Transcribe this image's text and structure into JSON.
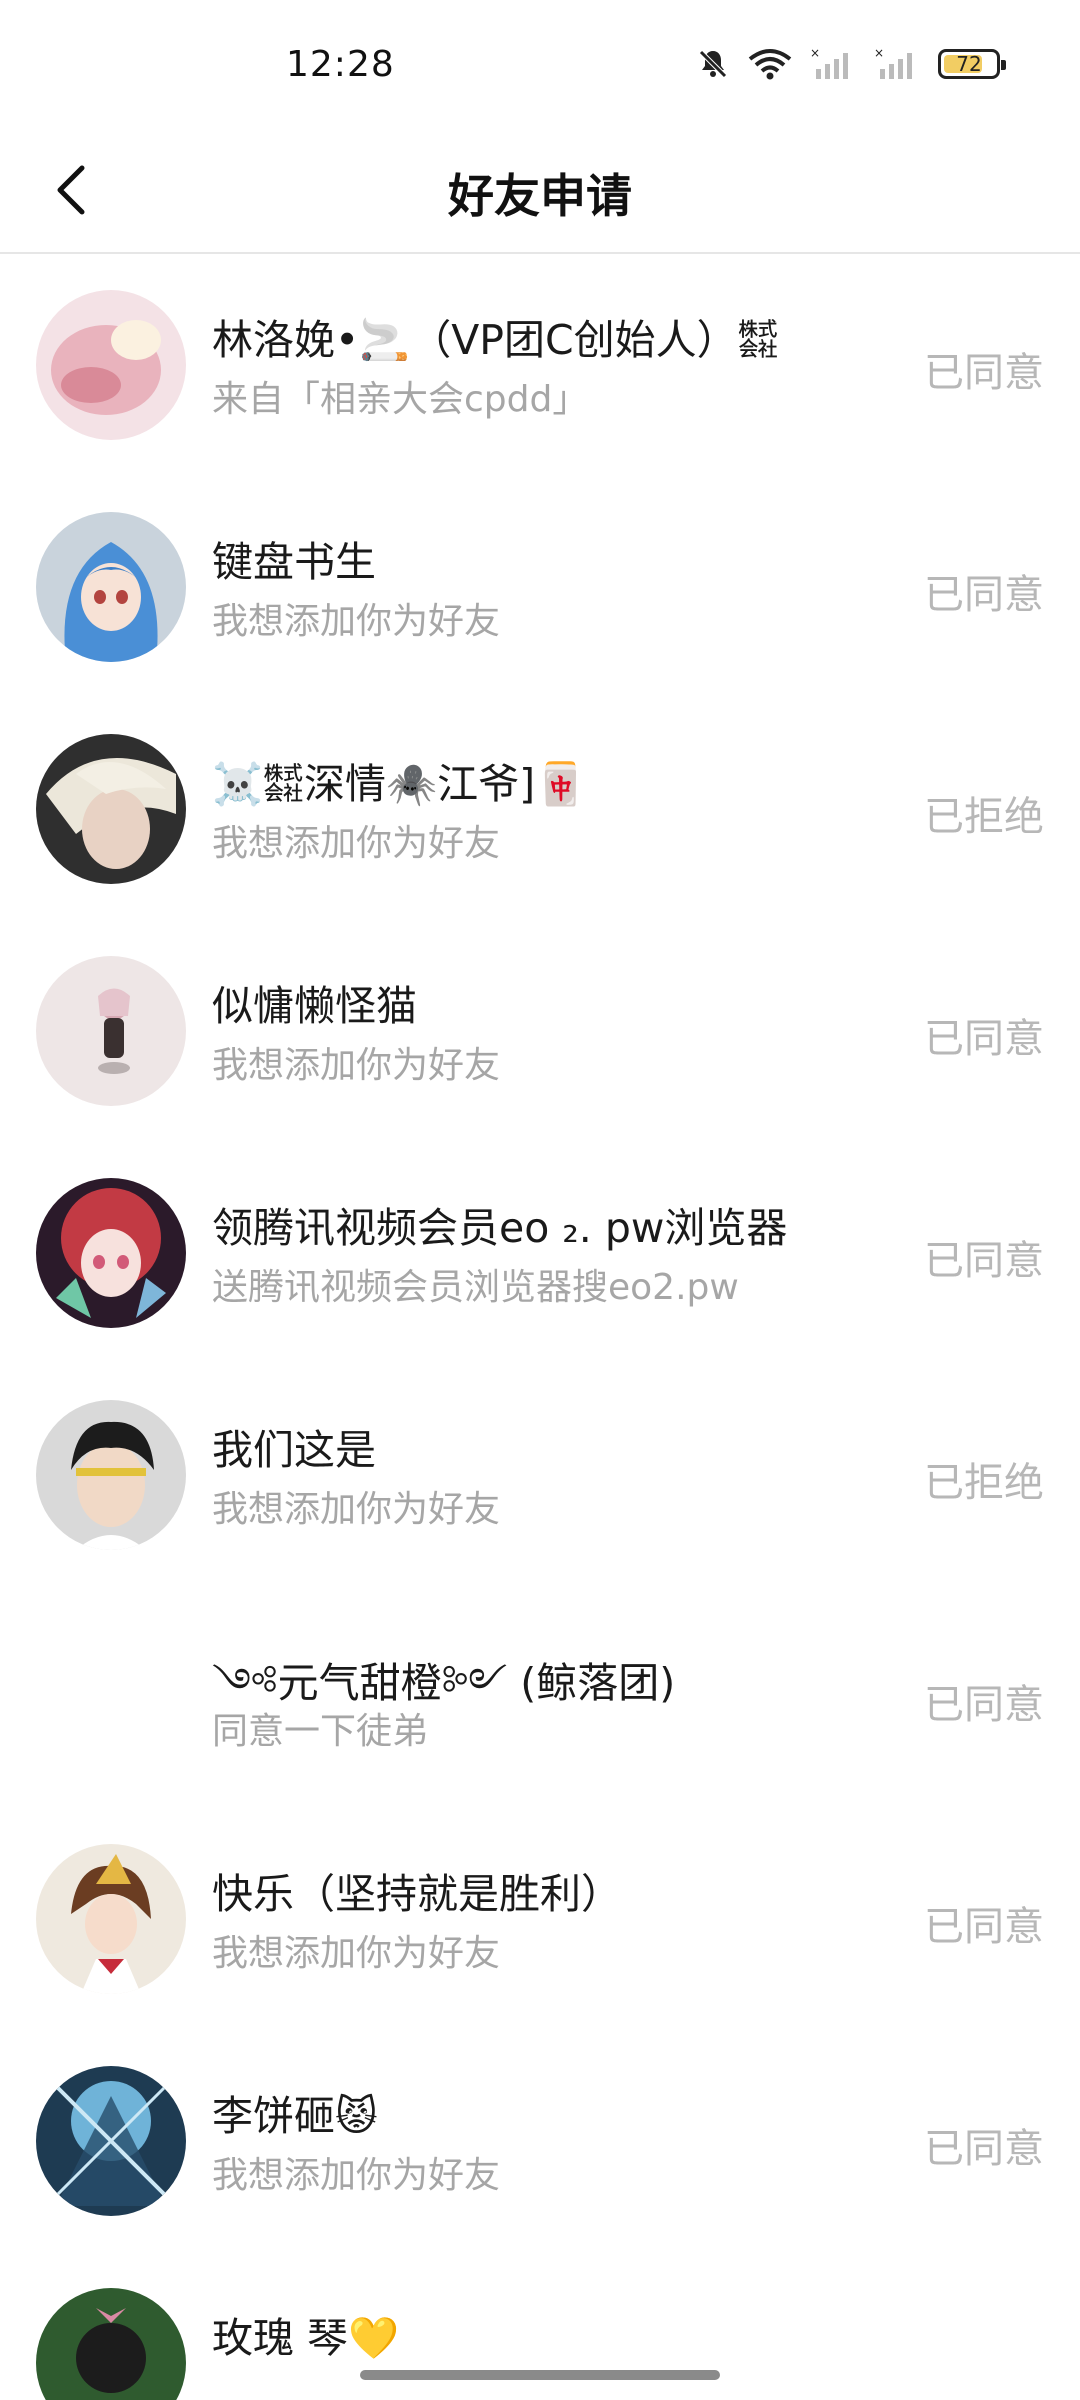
{
  "status_bar": {
    "time": "12:28",
    "battery": "72",
    "icons": [
      "bell-muted-icon",
      "wifi-icon",
      "signal-icon",
      "signal-icon",
      "battery-icon"
    ]
  },
  "header": {
    "title": "好友申请",
    "back_icon": "chevron-left-icon"
  },
  "requests": [
    {
      "name": "林洛娩•🚬（VP团C创始人）㍿",
      "message": "来自「相亲大会cpdd」",
      "status": "已同意"
    },
    {
      "name": "键盘书生",
      "message": "我想添加你为好友",
      "status": "已同意"
    },
    {
      "name": "☠️㍿深情🕷️江爷]🀄",
      "message": "我想添加你为好友",
      "status": "已拒绝"
    },
    {
      "name": "似慵懒怪猫",
      "message": "我想添加你为好友",
      "status": "已同意"
    },
    {
      "name": "领腾讯视频会员eo ₂. pw浏览器",
      "message": "送腾讯视频会员浏览器搜eo2.pw",
      "status": "已同意"
    },
    {
      "name": "我们这是",
      "message": "我想添加你为好友",
      "status": "已拒绝"
    },
    {
      "name": "༺元气甜橙༻ (鲸落团)",
      "message": "同意一下徒弟",
      "status": "已同意"
    },
    {
      "name": "快乐（坚持就是胜利）",
      "message": "我想添加你为好友",
      "status": "已同意"
    },
    {
      "name": "李饼砸😾",
      "message": "我想添加你为好友",
      "status": "已同意"
    },
    {
      "name": "玫瑰 琴💛",
      "message": "",
      "status": ""
    }
  ],
  "colors": {
    "name_text": "#1a1a1a",
    "sub_text": "#a6a6a6",
    "status_text": "#b7b7b7",
    "divider": "#e6e6e6",
    "battery_fill": "#f2cd63"
  }
}
